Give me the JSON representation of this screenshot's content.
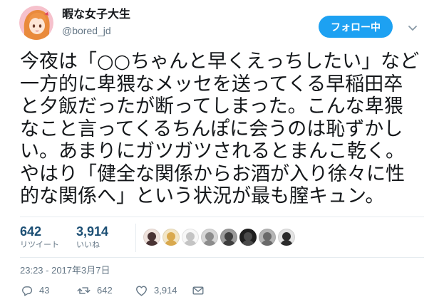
{
  "user": {
    "name": "暇な女子大生",
    "handle": "@bored_jd",
    "avatar_icon": "avatar-anime-girl"
  },
  "follow_button": {
    "label": "フォロー中",
    "color": "#1da1f2"
  },
  "menu_icon": "chevron-down-icon",
  "tweet": {
    "lines": [
      "今夜は「○○ちゃんと早くえっちしたい」など",
      "一方的に卑猥なメッセを送ってくる早稲田卒",
      "と夕飯だったが断ってしまった。こんな卑猥",
      "なこと言ってくるちんぽに会うのは恥ずかし",
      "い。あまりにガツガツされるとまんこ乾く。",
      "やはり「健全な関係からお酒が入り徐々に性",
      "的な関係へ」という状況が最も膣キュン。"
    ]
  },
  "stats": {
    "retweets": {
      "count": "642",
      "label": "リツイート"
    },
    "likes": {
      "count": "3,914",
      "label": "いいね"
    },
    "liker_avatars": [
      {
        "icon": "liker-avatar",
        "bg": "#efe2dc",
        "fg": "#4a3434"
      },
      {
        "icon": "liker-avatar",
        "bg": "#f3e6c6",
        "fg": "#d9a94e"
      },
      {
        "icon": "liker-avatar",
        "bg": "#f7f7f7",
        "fg": "#c4c4c4"
      },
      {
        "icon": "liker-avatar",
        "bg": "#d6d6d6",
        "fg": "#8c8c8c"
      },
      {
        "icon": "liker-avatar",
        "bg": "#9a9a9a",
        "fg": "#3e3e3e"
      },
      {
        "icon": "liker-avatar",
        "bg": "#1f1f1f",
        "fg": "#4a4a4a"
      },
      {
        "icon": "liker-avatar",
        "bg": "#b5b5b5",
        "fg": "#6a6a6a"
      },
      {
        "icon": "liker-avatar",
        "bg": "#e2e2e2",
        "fg": "#2b2b2b"
      }
    ]
  },
  "timestamp": "23:23 - 2017年3月7日",
  "actions": {
    "reply": {
      "icon": "reply-icon",
      "count": "43"
    },
    "retweet": {
      "icon": "retweet-icon",
      "count": "642"
    },
    "like": {
      "icon": "heart-icon",
      "count": "3,914"
    },
    "message": {
      "icon": "mail-icon"
    }
  },
  "colors": {
    "accent": "#1da1f2",
    "text": "#14171a",
    "muted": "#657786",
    "border": "#e6ecf0",
    "stat_count": "#1c4f74"
  }
}
